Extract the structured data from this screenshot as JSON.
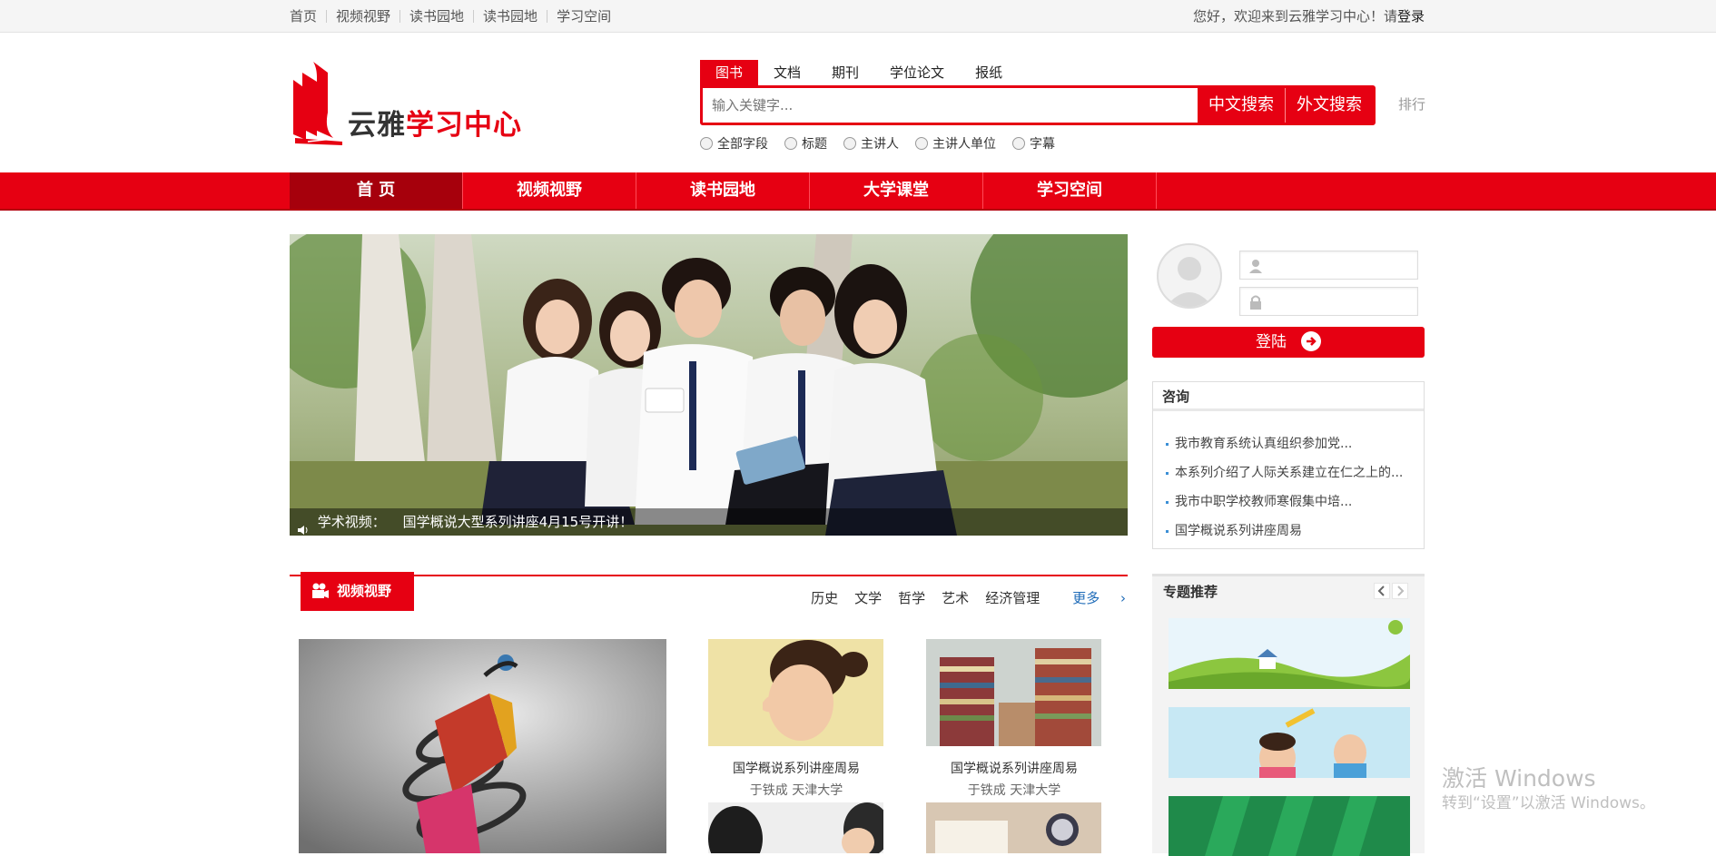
{
  "topbar": {
    "links": [
      "首页",
      "视频视野",
      "读书园地",
      "读书园地",
      "学习空间"
    ],
    "welcome": "您好，欢迎来到云雅学习中心！请",
    "login_link": "登录"
  },
  "logo": {
    "part1": "云雅",
    "part2": "学习中心"
  },
  "search": {
    "tabs": [
      "图书",
      "文档",
      "期刊",
      "学位论文",
      "报纸"
    ],
    "active_tab": "图书",
    "placeholder": "输入关键字...",
    "btn_cn": "中文搜索",
    "btn_foreign": "外文搜索",
    "options": [
      "全部字段",
      "标题",
      "主讲人",
      "主讲人单位",
      "字幕"
    ],
    "rank": "排行"
  },
  "nav": {
    "items": [
      "首 页",
      "视频视野",
      "读书园地",
      "大学课堂",
      "学习空间"
    ]
  },
  "banner": {
    "label": "学术视频：",
    "text": "国学概说大型系列讲座4月15号开讲！"
  },
  "login": {
    "button": "登陆"
  },
  "consult": {
    "title": "咨询",
    "items": [
      "我市教育系统认真组织参加党...",
      "本系列介绍了人际关系建立在仁之上的...",
      "我市中职学校教师寒假集中培...",
      "国学概说系列讲座周易"
    ]
  },
  "video_section": {
    "title": "视频视野",
    "tabs": [
      "历史",
      "文学",
      "哲学",
      "艺术",
      "经济管理"
    ],
    "more": "更多",
    "cards": [
      {
        "title": "国学概说系列讲座周易",
        "sub": "于铁成 天津大学"
      },
      {
        "title": "国学概说系列讲座周易",
        "sub": "于铁成 天津大学"
      }
    ]
  },
  "topics": {
    "title": "专题推荐"
  },
  "watermark": {
    "line1": "激活 Windows",
    "line2": "转到“设置”以激活 Windows。"
  },
  "colors": {
    "brand_red": "#e60012",
    "nav_active": "#a6000c"
  }
}
